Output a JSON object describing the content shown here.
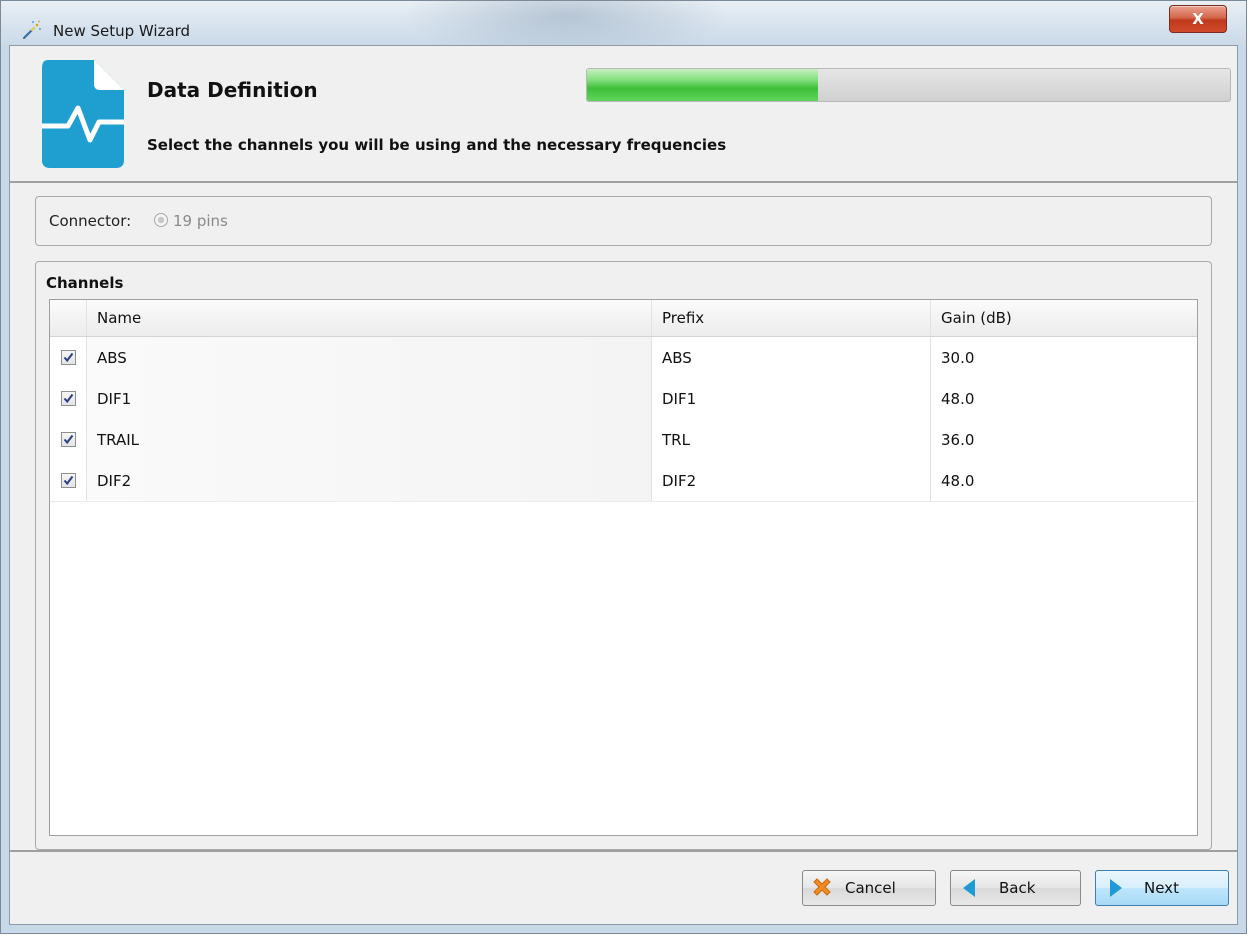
{
  "window": {
    "title": "New Setup Wizard",
    "close_label": "X"
  },
  "header": {
    "title": "Data Definition",
    "subtitle": "Select the channels you will be using and the necessary frequencies",
    "progress_fraction": 0.36,
    "progress_color": "#4ccb47",
    "icon_color": "#1e9fd0",
    "icon": "document-waveform-icon"
  },
  "connector": {
    "label": "Connector:",
    "value": "19 pins"
  },
  "channels": {
    "title": "Channels",
    "columns": [
      "",
      "Name",
      "Prefix",
      "Gain (dB)"
    ],
    "rows": [
      {
        "checked": true,
        "name": "ABS",
        "prefix": "ABS",
        "gain": "30.0"
      },
      {
        "checked": true,
        "name": "DIF1",
        "prefix": "DIF1",
        "gain": "48.0"
      },
      {
        "checked": true,
        "name": "TRAIL",
        "prefix": "TRL",
        "gain": "36.0"
      },
      {
        "checked": true,
        "name": "DIF2",
        "prefix": "DIF2",
        "gain": "48.0"
      }
    ]
  },
  "footer": {
    "cancel_label": "Cancel",
    "back_label": "Back",
    "next_label": "Next"
  }
}
